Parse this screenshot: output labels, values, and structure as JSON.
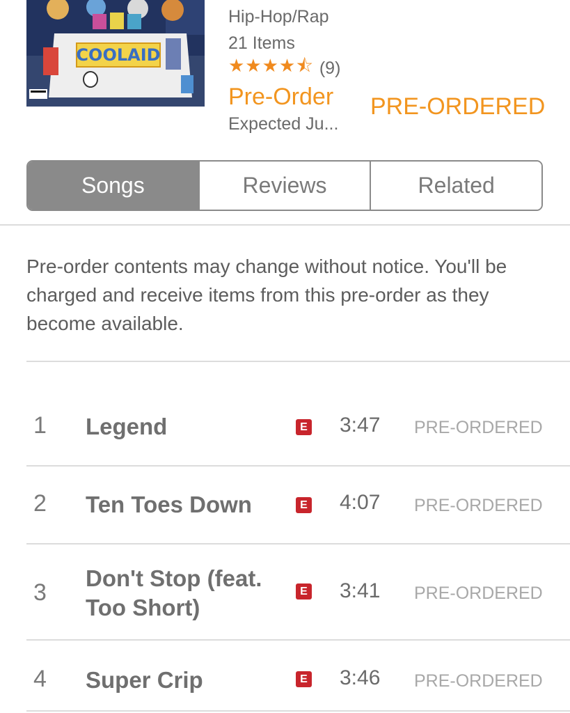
{
  "album": {
    "genre": "Hip-Hop/Rap",
    "item_count": "21 Items",
    "rating_stars": "★★★★⯪",
    "rating_value": 4.5,
    "rating_count": "(9)",
    "price_label": "Pre-Order",
    "release_note": "Expected Ju...",
    "purchase_status": "PRE-ORDERED",
    "artwork_text": "COOLAID",
    "accent_color": "#f2951f"
  },
  "tabs": [
    {
      "label": "Songs",
      "active": true
    },
    {
      "label": "Reviews",
      "active": false
    },
    {
      "label": "Related",
      "active": false
    }
  ],
  "notice": "Pre-order contents may change without notice. You'll be charged and receive items from this pre-order as they become available.",
  "tracks": [
    {
      "number": "1",
      "title": "Legend",
      "explicit": "E",
      "duration": "3:47",
      "status": "PRE-ORDERED"
    },
    {
      "number": "2",
      "title": "Ten Toes Down",
      "explicit": "E",
      "duration": "4:07",
      "status": "PRE-ORDERED"
    },
    {
      "number": "3",
      "title": "Don't Stop (feat. Too Short)",
      "explicit": "E",
      "duration": "3:41",
      "status": "PRE-ORDERED"
    },
    {
      "number": "4",
      "title": "Super Crip",
      "explicit": "E",
      "duration": "3:46",
      "status": "PRE-ORDERED"
    }
  ]
}
